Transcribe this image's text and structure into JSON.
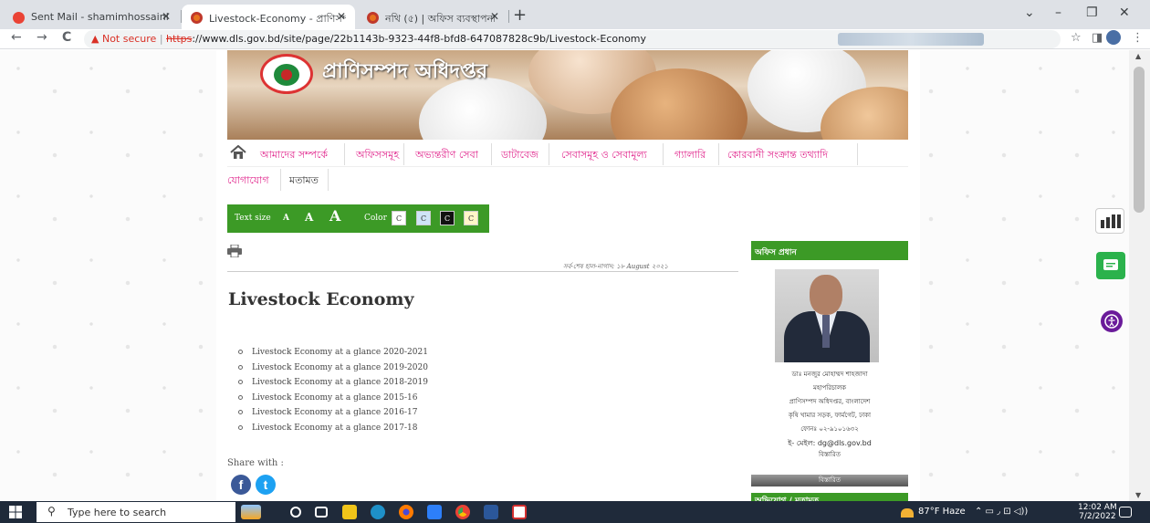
{
  "browser": {
    "tabs": [
      {
        "title": "Sent Mail - shamimhossainlms@",
        "favicon_color": "#ea4335",
        "active": false
      },
      {
        "title": "Livestock-Economy - প্রাণিসম্পদ",
        "favicon_color": "#e8731f",
        "active": true
      },
      {
        "title": "নথি (৫) | অফিস ব্যবস্থাপনা",
        "favicon_color": "#e8731f",
        "active": false
      }
    ],
    "new_tab": "+",
    "window_controls": {
      "dropdown": "⌄",
      "minimize": "–",
      "restore": "❐",
      "close": "✕"
    },
    "nav": {
      "back": "←",
      "forward": "→",
      "reload": "C"
    },
    "address": {
      "security_icon": "▲",
      "security_label": "Not secure",
      "separator": "|",
      "scheme": "https",
      "url": "://www.dls.gov.bd/site/page/22b1143b-9323-44f8-bfd8-647087828c9b/Livestock-Economy"
    },
    "extensions": [
      "☆",
      "◨",
      "⋮"
    ]
  },
  "site": {
    "title": "প্রাণিসম্পদ অধিদপ্তর",
    "menu_row1": [
      "আমাদের সম্পর্কে",
      "অফিসসমূহ",
      "অভ্যন্তরীণ সেবা",
      "ডাটাবেজ",
      "সেবাসমূহ ও সেবামূল্য",
      "গ্যালারি",
      "কোরবানী সংক্রান্ত তথ্যাদি"
    ],
    "menu_row2": [
      "যোগাযোগ",
      "মতামত"
    ],
    "a11y": {
      "text_size_label": "Text size",
      "sizes": [
        "A",
        "A",
        "A"
      ],
      "color_label": "Color",
      "colors": [
        {
          "label": "C",
          "bg": "#ffffff",
          "fg": "#333333"
        },
        {
          "label": "C",
          "bg": "#cfe4f7",
          "fg": "#333333"
        },
        {
          "label": "C",
          "bg": "#111111",
          "fg": "#ffffff"
        },
        {
          "label": "C",
          "bg": "#fff6c8",
          "fg": "#333333"
        }
      ]
    },
    "last_updated": "সর্ব-শেষ হাল-নাগাদ: ১৮ August ২০২১",
    "page_title": "Livestock Economy",
    "documents": [
      "Livestock Economy at a glance 2020-2021",
      "Livestock Economy at a glance 2019-2020",
      "Livestock Economy at a glance 2018-2019",
      "Livestock Economy at a glance 2015-16",
      "Livestock Economy at a glance 2016-17",
      "Livestock Economy at a glance 2017-18"
    ],
    "share_label": "Share with :",
    "social": {
      "facebook": "f",
      "twitter": "t"
    },
    "sidebar": {
      "head_title": "অফিস প্রধান",
      "person": {
        "name": "ডাঃ মনজুর মোহাম্মদ শাহজাদা",
        "designation": "মহাপরিচালক",
        "office": "প্রাণিসম্পদ অধিদপ্তর, বাংলাদেশ",
        "address": "কৃষি খামার সড়ক, ফার্মগেট, ঢাকা",
        "phone": "ফোনঃ ০২-৯১০১৬৩২",
        "email": "ই- মেইল: dg@dls.gov.bd"
      },
      "details": "বিস্তারিত",
      "details_button": "বিস্তারিত",
      "second_head": "অভিযোগ / মতামত"
    }
  },
  "taskbar": {
    "search_placeholder": "Type here to search",
    "weather": "87°F Haze",
    "tray_symbols": "⌃ ▭ ◞ ⊡ ◁))",
    "time": "12:02 AM",
    "date": "7/2/2022"
  }
}
